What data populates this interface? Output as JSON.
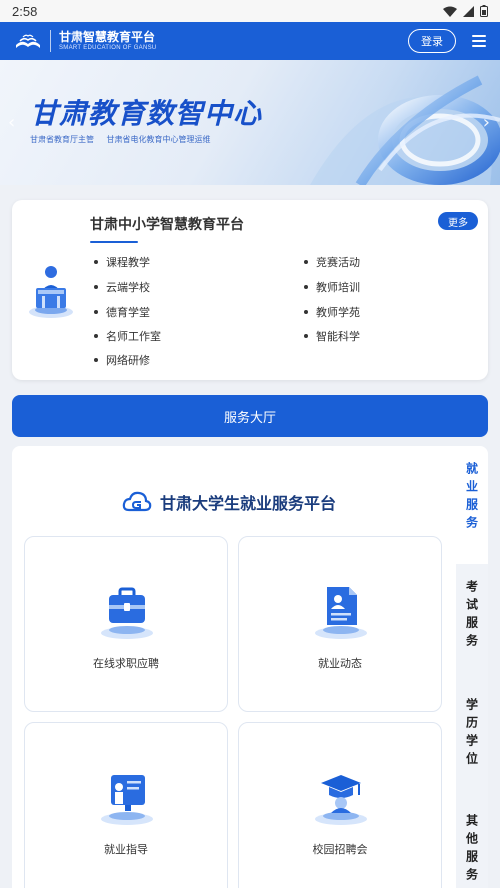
{
  "status_bar": {
    "time": "2:58"
  },
  "header": {
    "logo_name": "甘肃智慧教育平台",
    "logo_sub": "SMART EDUCATION OF GANSU",
    "login_label": "登录"
  },
  "banner": {
    "title": "甘肃教育数智中心",
    "subtitle_1": "甘肃省教育厅主管",
    "subtitle_2": "甘肃省电化教育中心管理运维"
  },
  "platform": {
    "title": "甘肃中小学智慧教育平台",
    "more_label": "更多",
    "links": [
      "课程教学",
      "竞赛活动",
      "云端学校",
      "教师培训",
      "德育学堂",
      "教师学苑",
      "名师工作室",
      "智能科学",
      "网络研修"
    ]
  },
  "service_hall": {
    "label": "服务大厅"
  },
  "employment": {
    "title": "甘肃大学生就业服务平台",
    "cards": [
      {
        "label": "在线求职应聘",
        "icon": "briefcase-icon"
      },
      {
        "label": "就业动态",
        "icon": "document-profile-icon"
      },
      {
        "label": "就业指导",
        "icon": "presentation-board-icon"
      },
      {
        "label": "校园招聘会",
        "icon": "graduation-cap-icon"
      }
    ]
  },
  "side_tabs": [
    {
      "label": "就业服务",
      "active": true
    },
    {
      "label": "考试服务",
      "active": false
    },
    {
      "label": "学历学位",
      "active": false
    },
    {
      "label": "其他服务",
      "active": false
    }
  ],
  "colors": {
    "primary": "#1a5fd6",
    "title_blue": "#1750c9"
  }
}
